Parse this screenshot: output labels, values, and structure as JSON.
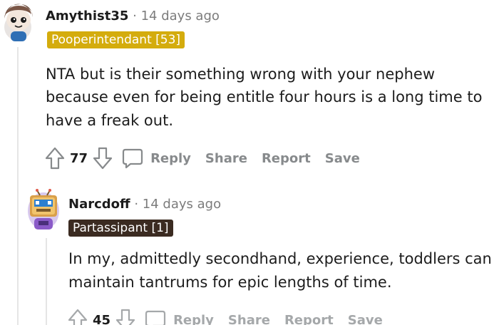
{
  "comments": [
    {
      "username": "Amythist35",
      "separator": "·",
      "time": "14 days ago",
      "flair": "Pooperintendant [53]",
      "body_lines": [
        "NTA but is their something wrong with your nephew",
        "because even for being entitle four hours is a long time to",
        "have a freak out."
      ],
      "score": "77",
      "actions": {
        "reply": "Reply",
        "share": "Share",
        "report": "Report",
        "save": "Save"
      }
    },
    {
      "username": "Narcdoff",
      "separator": "·",
      "time": "14 days ago",
      "flair": "Partassipant [1]",
      "body_lines": [
        "In my, admittedly secondhand, experience, toddlers can",
        "maintain tantrums for epic lengths of time."
      ],
      "score": "45",
      "actions": {
        "reply": "Reply",
        "share": "Share",
        "report": "Report",
        "save": "Save"
      }
    }
  ],
  "colors": {
    "flair_gold": "#d4ac0d",
    "flair_dark": "#3b2b21",
    "action_gray": "#878a8c",
    "thread_line": "#e5e5e5"
  },
  "icons": {
    "upvote": "arrow-up-icon",
    "downvote": "arrow-down-icon",
    "reply": "speech-bubble-icon"
  }
}
